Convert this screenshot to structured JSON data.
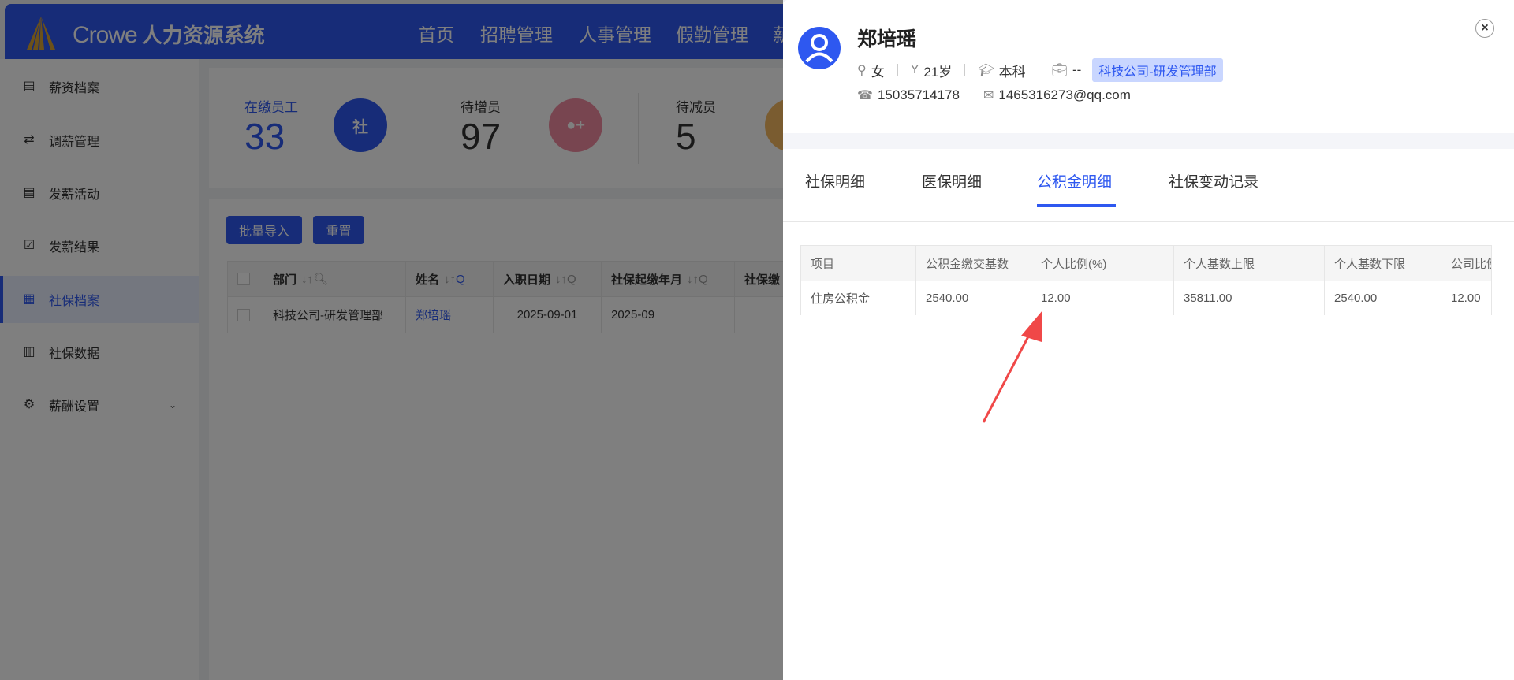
{
  "header": {
    "brand": "Crowe",
    "system": "人力资源系统",
    "nav": [
      "首页",
      "招聘管理",
      "人事管理",
      "假勤管理",
      "薪"
    ]
  },
  "sidebar": {
    "items": [
      {
        "label": "薪资档案",
        "icon": "file-icon"
      },
      {
        "label": "调薪管理",
        "icon": "exchange-icon"
      },
      {
        "label": "发薪活动",
        "icon": "clipboard-icon"
      },
      {
        "label": "发薪结果",
        "icon": "check-clipboard-icon"
      },
      {
        "label": "社保档案",
        "icon": "grid-icon"
      },
      {
        "label": "社保数据",
        "icon": "bar-chart-icon"
      },
      {
        "label": "薪酬设置",
        "icon": "gear-icon"
      }
    ]
  },
  "stats": [
    {
      "label": "在缴员工",
      "value": "33",
      "icon": "社"
    },
    {
      "label": "待增员",
      "value": "97"
    },
    {
      "label": "待减员",
      "value": "5"
    }
  ],
  "toolbar": {
    "import": "批量导入",
    "reset": "重置"
  },
  "table": {
    "headers": [
      "部门",
      "姓名",
      "入职日期",
      "社保起缴年月",
      "社保缴"
    ],
    "rows": [
      [
        "科技公司-研发管理部",
        "郑培瑶",
        "2025-09-01",
        "2025-09",
        ""
      ]
    ]
  },
  "drawer": {
    "name": "郑培瑶",
    "gender": "女",
    "age": "21岁",
    "education": "本科",
    "position": "--",
    "department": "科技公司-研发管理部",
    "phone": "15035714178",
    "email": "1465316273@qq.com",
    "tabs": [
      "社保明细",
      "医保明细",
      "公积金明细",
      "社保变动记录"
    ],
    "active_tab": 2,
    "table": {
      "headers": [
        "项目",
        "公积金缴交基数",
        "个人比例(%)",
        "个人基数上限",
        "个人基数下限",
        "公司比例"
      ],
      "rows": [
        [
          "住房公积金",
          "2540.00",
          "12.00",
          "35811.00",
          "2540.00",
          "12.00"
        ]
      ]
    },
    "close": "×"
  },
  "colors": {
    "primary": "#2e58f0",
    "annotation": "#f04848"
  }
}
